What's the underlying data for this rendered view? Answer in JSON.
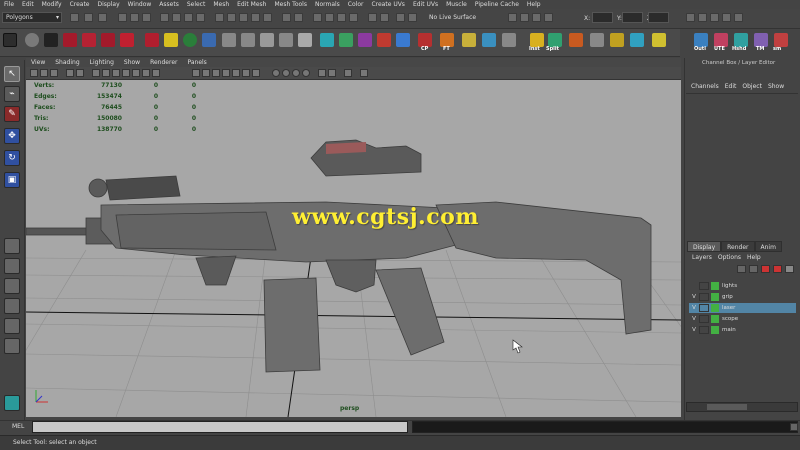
{
  "menubar": {
    "items": [
      "File",
      "Edit",
      "Modify",
      "Create",
      "Display",
      "Window",
      "Assets",
      "Select",
      "Mesh",
      "Edit Mesh",
      "Mesh Tools",
      "Normals",
      "Color",
      "Create UVs",
      "Edit UVs",
      "Muscle",
      "Pipeline Cache",
      "Help"
    ]
  },
  "status": {
    "mode": "Polygons",
    "live_surface": "No Live Surface",
    "coord_labels": [
      "X:",
      "Y:",
      "Z:"
    ]
  },
  "shelf": {
    "labels": [
      "CP",
      "FT",
      "Inst",
      "Split",
      "Outl",
      "UTE",
      "Hshd",
      "TM",
      "sm"
    ]
  },
  "viewport": {
    "menu": [
      "View",
      "Shading",
      "Lighting",
      "Show",
      "Renderer",
      "Panels"
    ],
    "hud": [
      {
        "label": "Verts:",
        "v1": "77130",
        "v2": "0",
        "v3": "0"
      },
      {
        "label": "Edges:",
        "v1": "153474",
        "v2": "0",
        "v3": "0"
      },
      {
        "label": "Faces:",
        "v1": "76445",
        "v2": "0",
        "v3": "0"
      },
      {
        "label": "Tris:",
        "v1": "150080",
        "v2": "0",
        "v3": "0"
      },
      {
        "label": "UVs:",
        "v1": "138770",
        "v2": "0",
        "v3": "0"
      }
    ],
    "camera": "persp",
    "watermark": "www.cgtsj.com"
  },
  "channel_box": {
    "title": "Channel Box / Layer Editor",
    "menu": [
      "Channels",
      "Edit",
      "Object",
      "Show"
    ]
  },
  "layer_editor": {
    "tabs": [
      "Display",
      "Render",
      "Anim"
    ],
    "menu": [
      "Layers",
      "Options",
      "Help"
    ],
    "layers": [
      {
        "v": "",
        "name": "lights"
      },
      {
        "v": "V",
        "name": "grip"
      },
      {
        "v": "V",
        "name": "laser"
      },
      {
        "v": "V",
        "name": "scope"
      },
      {
        "v": "V",
        "name": "main"
      }
    ]
  },
  "command": {
    "label": "MEL",
    "help": "Select Tool: select an object"
  },
  "colors": {
    "viewport_bg": "#a7a7a7",
    "watermark": "#ffef33",
    "layer_swatch": "#43b043",
    "selected_row": "#5285a6"
  }
}
